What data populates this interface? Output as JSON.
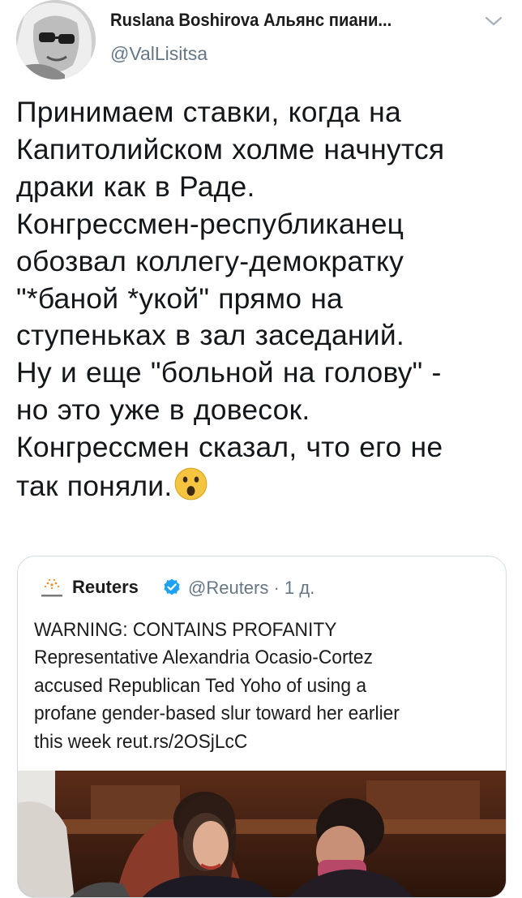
{
  "author": {
    "name": "Ruslana Boshirova Альянс пиани...",
    "handle": "@ValLisitsa"
  },
  "tweet": {
    "lines": [
      "Принимаем ставки, когда на",
      "Капитолийском холме начнутся",
      "драки как в Раде.",
      "Конгрессмен-республиканец",
      "обозвал коллегу-демократку",
      "\"*баной *укой\" прямо на",
      "ступеньках в зал заседаний.",
      "Ну и еще \"больной на голову\" -",
      "но это уже в довесок.",
      "Конгрессмен сказал, что его не",
      "так поняли."
    ]
  },
  "quoted_tweet": {
    "name": "Reuters",
    "handle_time": "@Reuters · 1 д.",
    "lines": [
      "WARNING: CONTAINS PROFANITY",
      "Representative Alexandria Ocasio-Cortez",
      "accused Republican Ted Yoho of using a",
      "profane gender-based slur toward her earlier",
      "this week reut.rs/2OSjLcC"
    ]
  },
  "icons": {
    "verified": "verified-badge-icon",
    "menu": "chevron-down-icon",
    "emoji": "astonished-face-emoji",
    "logo": "reuters-logo"
  },
  "colors": {
    "verified": "#1da1f2",
    "secondary_text": "#657786",
    "emoji": "#f5c542"
  }
}
